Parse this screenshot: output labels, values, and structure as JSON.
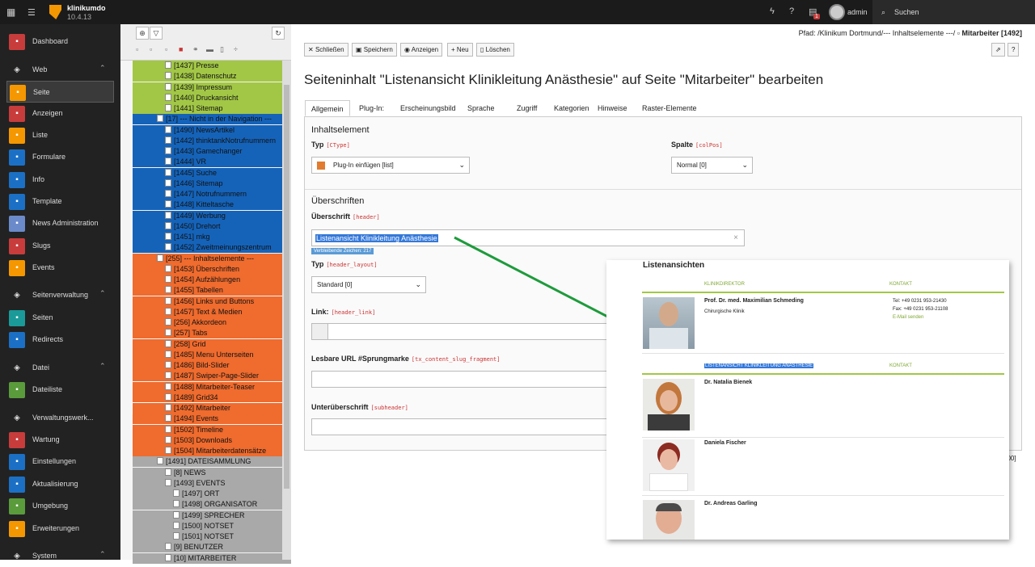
{
  "topbar": {
    "site": "klinikumdo",
    "version": "10.4.13",
    "badge": "1",
    "user": "admin",
    "search": "Suchen"
  },
  "colors": {
    "tree_green": "#a2c746",
    "tree_blue": "#1563b9",
    "tree_orange": "#ef6b2e",
    "tree_gray": "#a9a9a9",
    "arrow": "#1e9b3c"
  },
  "modules": [
    {
      "label": "Dashboard",
      "icon": "dashboard-icon",
      "color": "#c83c3c"
    },
    {
      "label": "Web",
      "icon": "web-icon",
      "group": true
    },
    {
      "label": "Seite",
      "icon": "page-icon",
      "color": "#f49700"
    },
    {
      "label": "Anzeigen",
      "icon": "eye-icon",
      "color": "#c83c3c"
    },
    {
      "label": "Liste",
      "icon": "list-icon",
      "color": "#f49700"
    },
    {
      "label": "Formulare",
      "icon": "form-icon",
      "color": "#1b70c5"
    },
    {
      "label": "Info",
      "icon": "info-icon",
      "color": "#1b70c5"
    },
    {
      "label": "Template",
      "icon": "template-icon",
      "color": "#1b70c5"
    },
    {
      "label": "News Administration",
      "icon": "news-icon",
      "color": "#6b8ac9"
    },
    {
      "label": "Slugs",
      "icon": "slug-icon",
      "color": "#c83c3c"
    },
    {
      "label": "Events",
      "icon": "events-icon",
      "color": "#f49700"
    },
    {
      "label": "Seitenverwaltung",
      "icon": "globe-icon",
      "group": true
    },
    {
      "label": "Seiten",
      "icon": "pages-icon",
      "color": "#1b9a9a"
    },
    {
      "label": "Redirects",
      "icon": "redirect-icon",
      "color": "#1b70c5"
    },
    {
      "label": "Datei",
      "icon": "file-icon",
      "group": true
    },
    {
      "label": "Dateiliste",
      "icon": "filelist-icon",
      "color": "#5a9b3c"
    },
    {
      "label": "Verwaltungswerk...",
      "icon": "rocket-icon",
      "group": true
    },
    {
      "label": "Wartung",
      "icon": "wrench-icon",
      "color": "#c83c3c"
    },
    {
      "label": "Einstellungen",
      "icon": "settings-icon",
      "color": "#1b70c5"
    },
    {
      "label": "Aktualisierung",
      "icon": "update-icon",
      "color": "#1b70c5"
    },
    {
      "label": "Umgebung",
      "icon": "environment-icon",
      "color": "#5a9b3c"
    },
    {
      "label": "Erweiterungen",
      "icon": "extensions-icon",
      "color": "#f49700"
    },
    {
      "label": "System",
      "icon": "system-icon",
      "group": true
    }
  ],
  "tree": [
    {
      "t": "[1437] Presse",
      "c": "g",
      "l": 1
    },
    {
      "t": "[1438] Datenschutz",
      "c": "g",
      "l": 1
    },
    {
      "t": "[1439] Impressum",
      "c": "g",
      "l": 1
    },
    {
      "t": "[1440] Druckansicht",
      "c": "g",
      "l": 1
    },
    {
      "t": "[1441] Sitemap",
      "c": "g",
      "l": 1
    },
    {
      "t": "[17] --- Nicht in der Navigation ---",
      "c": "b",
      "l": 0
    },
    {
      "t": "[1490] NewsArtikel",
      "c": "b",
      "l": 1
    },
    {
      "t": "[1442] thinktankNotrufnummern",
      "c": "b",
      "l": 1
    },
    {
      "t": "[1443] Gamechanger",
      "c": "b",
      "l": 1
    },
    {
      "t": "[1444] VR",
      "c": "b",
      "l": 1
    },
    {
      "t": "[1445] Suche",
      "c": "b",
      "l": 1
    },
    {
      "t": "[1446] Sitemap",
      "c": "b",
      "l": 1
    },
    {
      "t": "[1447] Notrufnummern",
      "c": "b",
      "l": 1
    },
    {
      "t": "[1448] Kitteltasche",
      "c": "b",
      "l": 1
    },
    {
      "t": "[1449] Werbung",
      "c": "b",
      "l": 1
    },
    {
      "t": "[1450] Drehort",
      "c": "b",
      "l": 1
    },
    {
      "t": "[1451] mkg",
      "c": "b",
      "l": 1
    },
    {
      "t": "[1452] Zweitmeinungszentrum",
      "c": "b",
      "l": 1
    },
    {
      "t": "[255] --- Inhaltselemente ---",
      "c": "o",
      "l": 0
    },
    {
      "t": "[1453] Überschriften",
      "c": "o",
      "l": 1
    },
    {
      "t": "[1454] Aufzählungen",
      "c": "o",
      "l": 1
    },
    {
      "t": "[1455] Tabellen",
      "c": "o",
      "l": 1
    },
    {
      "t": "[1456] Links und Buttons",
      "c": "o",
      "l": 1
    },
    {
      "t": "[1457] Text & Medien",
      "c": "o",
      "l": 1
    },
    {
      "t": "[256] Akkordeon",
      "c": "o",
      "l": 1
    },
    {
      "t": "[257] Tabs",
      "c": "o",
      "l": 1
    },
    {
      "t": "[258] Grid",
      "c": "o",
      "l": 1
    },
    {
      "t": "[1485] Menu Unterseiten",
      "c": "o",
      "l": 1
    },
    {
      "t": "[1486] Bild-Slider",
      "c": "o",
      "l": 1
    },
    {
      "t": "[1487] Swiper-Page-Slider",
      "c": "o",
      "l": 1
    },
    {
      "t": "[1488] Mitarbeiter-Teaser",
      "c": "o",
      "l": 1
    },
    {
      "t": "[1489] Grid34",
      "c": "o",
      "l": 1
    },
    {
      "t": "[1492] Mitarbeiter",
      "c": "o",
      "l": 1
    },
    {
      "t": "[1494] Events",
      "c": "o",
      "l": 1
    },
    {
      "t": "[1502] Timeline",
      "c": "o",
      "l": 1
    },
    {
      "t": "[1503] Downloads",
      "c": "o",
      "l": 1
    },
    {
      "t": "[1504] Mitarbeiterdatensätze",
      "c": "o",
      "l": 1
    },
    {
      "t": "[1491] DATEISAMMLUNG",
      "c": "s",
      "l": 0
    },
    {
      "t": "[8] NEWS",
      "c": "s",
      "l": 1
    },
    {
      "t": "[1493] EVENTS",
      "c": "s",
      "l": 1
    },
    {
      "t": "[1497] ORT",
      "c": "s",
      "l": 2
    },
    {
      "t": "[1498] ORGANISATOR",
      "c": "s",
      "l": 2
    },
    {
      "t": "[1499] SPRECHER",
      "c": "s",
      "l": 2
    },
    {
      "t": "[1500] NOTSET",
      "c": "s",
      "l": 2
    },
    {
      "t": "[1501] NOTSET",
      "c": "s",
      "l": 2
    },
    {
      "t": "[9] BENUTZER",
      "c": "s",
      "l": 1
    },
    {
      "t": "[10] MITARBEITER",
      "c": "s",
      "l": 1
    }
  ],
  "path": {
    "label": "Pfad: /Klinikum Dortmund/--- Inhaltselemente ---/",
    "current": "Mitarbeiter [1492]"
  },
  "docbar": {
    "close": "Schließen",
    "save": "Speichern",
    "view": "Anzeigen",
    "new": "Neu",
    "delete": "Löschen"
  },
  "heading": "Seiteninhalt \"Listenansicht Klinikleitung Anästhesie\" auf Seite \"Mitarbeiter\" bearbeiten",
  "tabs": [
    "Allgemein",
    "Plug-In:",
    "Erscheinungsbild",
    "Sprache",
    "Zugriff",
    "Kategorien",
    "Hinweise",
    "Raster-Elemente"
  ],
  "form": {
    "section1": "Inhaltselement",
    "ctype_label": "Typ",
    "ctype_code": "[CType]",
    "ctype_value": "Plug-In einfügen [list]",
    "colpos_label": "Spalte",
    "colpos_code": "[colPos]",
    "colpos_value": "Normal [0]",
    "section2": "Überschriften",
    "header_label": "Überschrift",
    "header_code": "[header]",
    "header_value": "Listenansicht Klinikleitung Anästhesie",
    "remaining": "Verbleibende Zeichen: 217",
    "layout_label": "Typ",
    "layout_code": "[header_layout]",
    "layout_value": "Standard [0]",
    "link_label": "Link:",
    "link_code": "[header_link]",
    "slug_label": "Lesbare URL #Sprungmarke",
    "slug_code": "[tx_content_slug_fragment]",
    "sub_label": "Unterüberschrift",
    "sub_code": "[subheader]",
    "side_fragment": "200]"
  },
  "overlay": {
    "title": "Listenansichten",
    "col1": "KLINIKDIREKTOR",
    "col2": "Kontakt",
    "p1_name": "Prof. Dr. med. Maximilian Schmeding",
    "p1_sub": "Chirurgische Klinik",
    "p1_tel": "Tel: +49 0231 953-21430",
    "p1_fax": "Fax: +49 0231 953-21108",
    "p1_mail": "E-Mail senden",
    "col3": "LISTENANSICHT KLINIKLEITUNG ANÄSTHESIE",
    "col4": "Kontakt",
    "p2_name": "Dr. Natalia Bienek",
    "p3_name": "Daniela Fischer",
    "p4_name": "Dr. Andreas Garling"
  }
}
